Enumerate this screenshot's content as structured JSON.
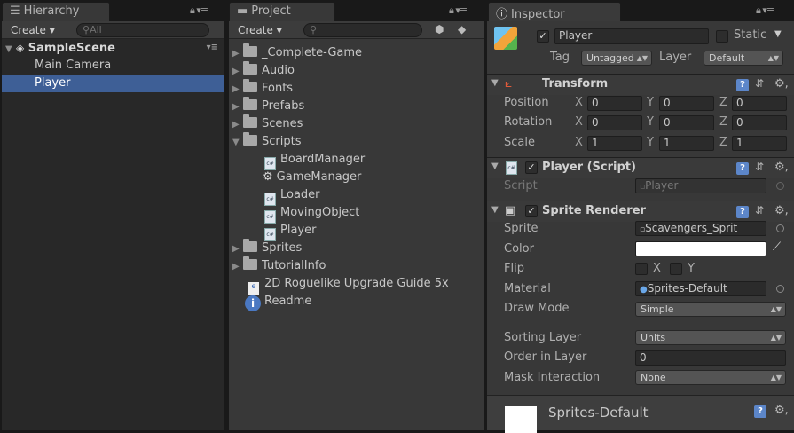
{
  "hierarchy": {
    "tab": "Hierarchy",
    "create": "Create",
    "search_placeholder": "All",
    "scene": "SampleScene",
    "items": [
      "Main Camera",
      "Player"
    ]
  },
  "project": {
    "tab": "Project",
    "create": "Create",
    "tree": [
      {
        "label": "_Complete-Game",
        "icon": "folder"
      },
      {
        "label": "Audio",
        "icon": "folder"
      },
      {
        "label": "Fonts",
        "icon": "folder"
      },
      {
        "label": "Prefabs",
        "icon": "folder"
      },
      {
        "label": "Scenes",
        "icon": "folder"
      },
      {
        "label": "Scripts",
        "icon": "folder",
        "open": true
      },
      {
        "label": "BoardManager",
        "icon": "cs-script"
      },
      {
        "label": "GameManager",
        "icon": "gear"
      },
      {
        "label": "Loader",
        "icon": "cs-script"
      },
      {
        "label": "MovingObject",
        "icon": "cs-script"
      },
      {
        "label": "Player",
        "icon": "cs-script"
      },
      {
        "label": "Sprites",
        "icon": "folder"
      },
      {
        "label": "TutorialInfo",
        "icon": "folder"
      },
      {
        "label": "2D Roguelike Upgrade Guide 5x",
        "icon": "pdf"
      },
      {
        "label": "Readme",
        "icon": "info"
      }
    ]
  },
  "inspector": {
    "tab": "Inspector",
    "object_name": "Player",
    "static_label": "Static",
    "tag_label": "Tag",
    "tag_value": "Untagged",
    "layer_label": "Layer",
    "layer_value": "Default",
    "transform": {
      "title": "Transform",
      "position_label": "Position",
      "rotation_label": "Rotation",
      "scale_label": "Scale",
      "position": [
        "0",
        "0",
        "0"
      ],
      "rotation": [
        "0",
        "0",
        "0"
      ],
      "scale": [
        "1",
        "1",
        "1"
      ],
      "axes": [
        "X",
        "Y",
        "Z"
      ]
    },
    "player_script": {
      "title": "Player (Script)",
      "script_label": "Script",
      "script_value": "Player"
    },
    "sprite_renderer": {
      "title": "Sprite Renderer",
      "sprite_label": "Sprite",
      "sprite_value": "Scavengers_Sprit",
      "color_label": "Color",
      "flip_label": "Flip",
      "flip_x": "X",
      "flip_y": "Y",
      "material_label": "Material",
      "material_value": "Sprites-Default",
      "draw_mode_label": "Draw Mode",
      "draw_mode_value": "Simple",
      "sorting_layer_label": "Sorting Layer",
      "sorting_layer_value": "Units",
      "order_label": "Order in Layer",
      "order_value": "0",
      "mask_label": "Mask Interaction",
      "mask_value": "None"
    },
    "material_preview": {
      "name": "Sprites-Default"
    }
  },
  "colors": {
    "selection": "#3e5f96",
    "panel": "#383838"
  }
}
